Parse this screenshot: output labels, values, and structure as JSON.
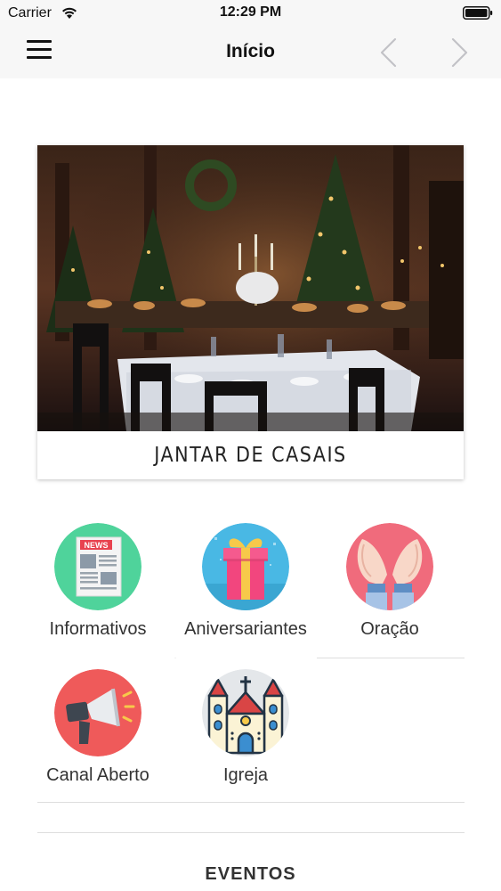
{
  "status_bar": {
    "carrier": "Carrier",
    "time": "12:29 PM"
  },
  "nav": {
    "title": "Início",
    "back_icon": "chevron-left-icon",
    "forward_icon": "chevron-right-icon",
    "menu_icon": "hamburger-menu-icon"
  },
  "featured": {
    "caption": "JANTAR DE CASAIS"
  },
  "menu": {
    "items": [
      {
        "label": "Informativos",
        "icon": "newspaper-icon",
        "color": "#4fd39b"
      },
      {
        "label": "Aniversariantes",
        "icon": "gift-icon",
        "color": "#49b8e4"
      },
      {
        "label": "Oração",
        "icon": "praying-hands-icon",
        "color": "#f06b7c"
      },
      {
        "label": "Canal Aberto",
        "icon": "megaphone-icon",
        "color": "#ef5a5a"
      },
      {
        "label": "Igreja",
        "icon": "church-icon",
        "color": "#e4e7ea"
      }
    ]
  },
  "events": {
    "heading": "EVENTOS"
  }
}
